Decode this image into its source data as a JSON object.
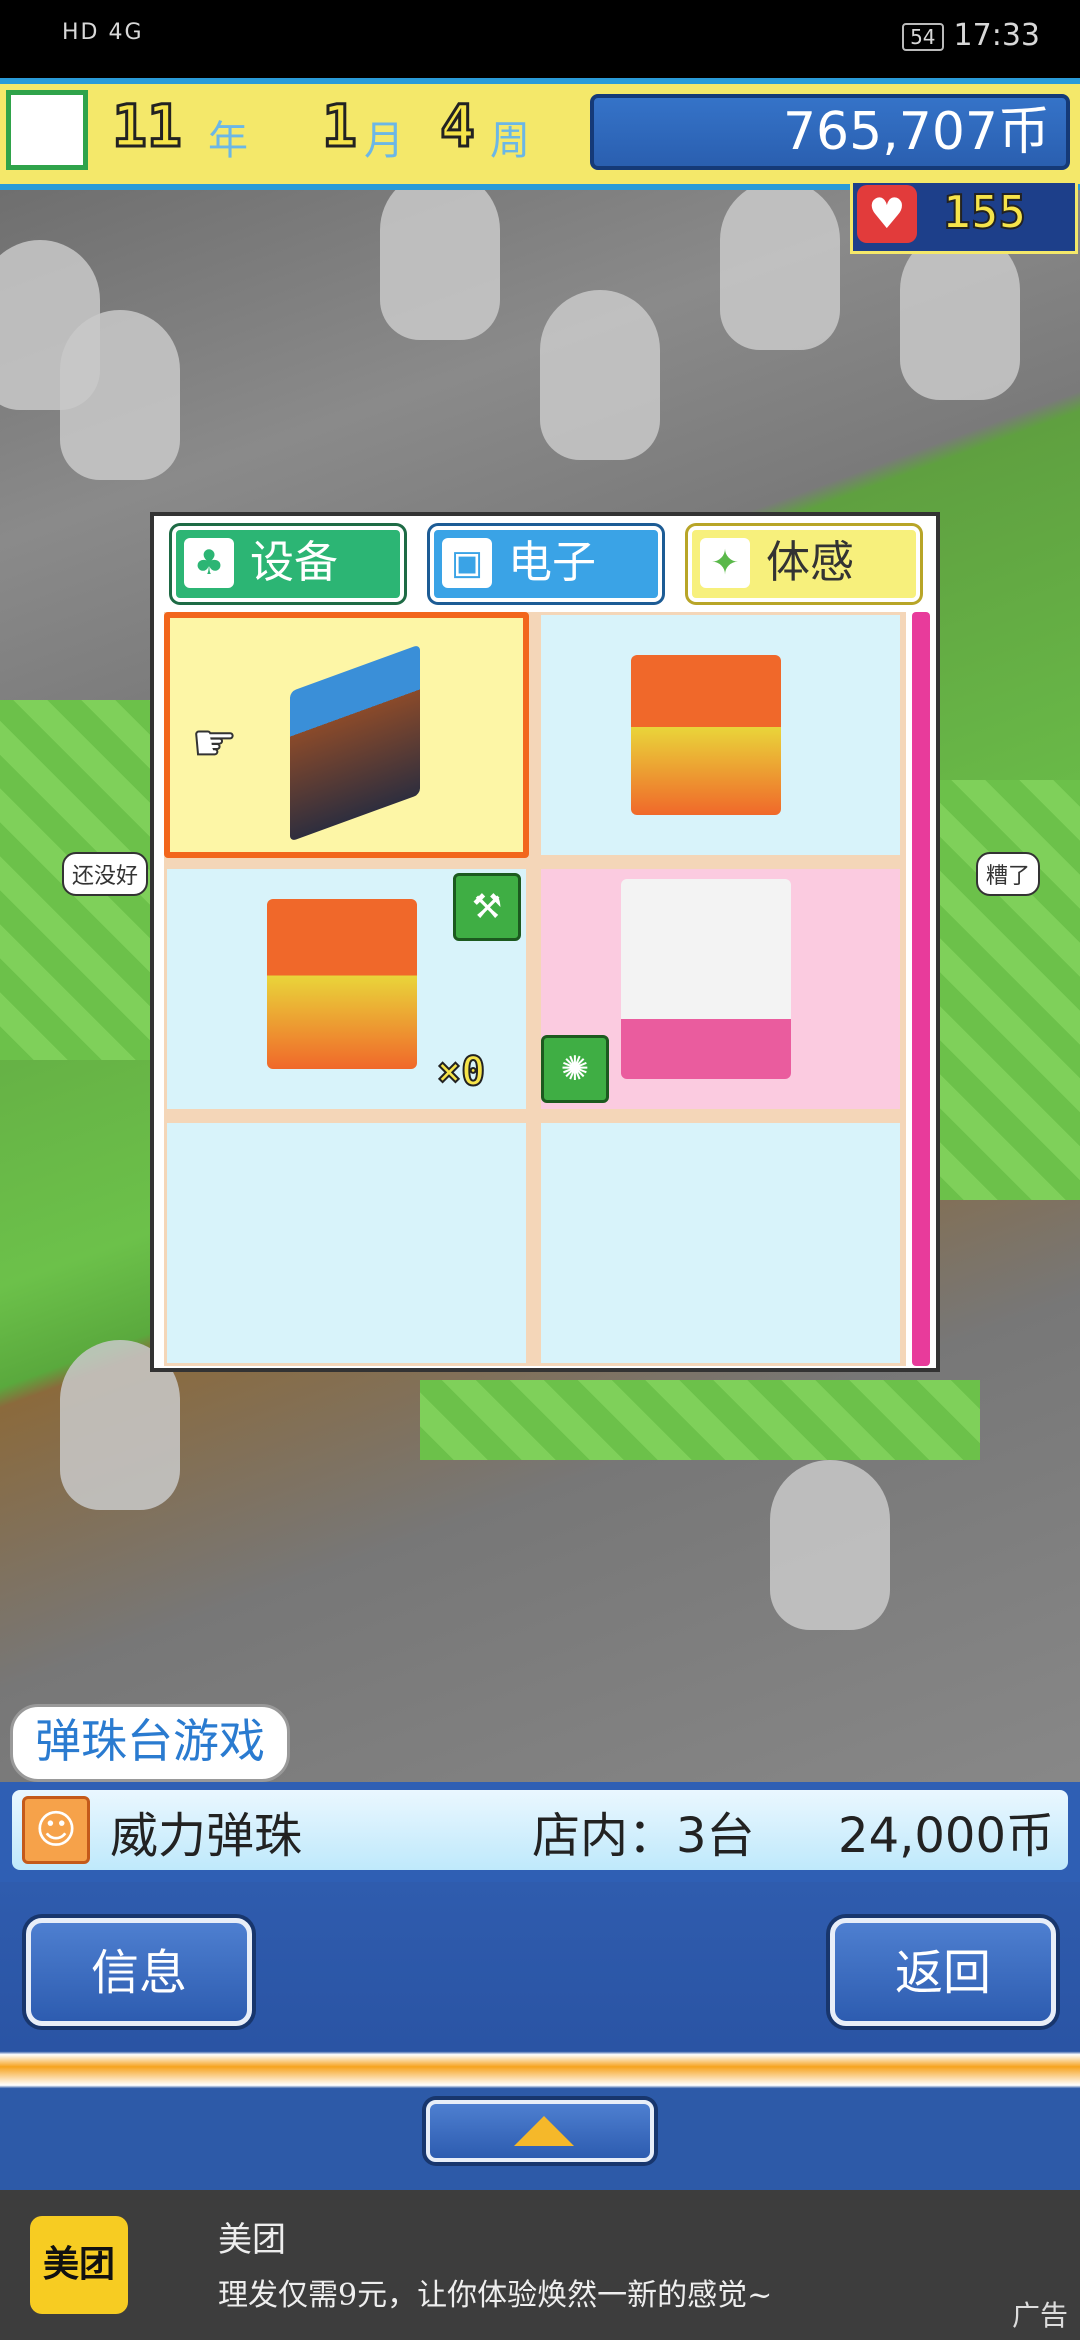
{
  "status_bar": {
    "network": "HD 4G",
    "battery": "54",
    "time": "17:33"
  },
  "hud": {
    "year_value": "11",
    "year_unit": "年",
    "month_value": "1",
    "month_unit": "月",
    "week_value": "4",
    "week_unit": "周",
    "money": "765,707币",
    "hearts": "155"
  },
  "panel": {
    "tabs": [
      {
        "label": "设备",
        "icon": "bench-icon"
      },
      {
        "label": "电子",
        "icon": "computer-icon"
      },
      {
        "label": "体感",
        "icon": "motion-icon"
      }
    ],
    "items": [
      {
        "name": "pinball-machine",
        "selected": true
      },
      {
        "name": "whack-a-mole-machine"
      },
      {
        "name": "whack-a-mole-machine",
        "badge": "wrench-icon",
        "count": "×0"
      },
      {
        "name": "crane-game-machine",
        "badge": "crab-icon"
      }
    ]
  },
  "bubbles": {
    "left": "还没好",
    "right": "糟了"
  },
  "item_info": {
    "category": "弹珠台游戏",
    "name": "威力弹珠",
    "stock": "店内：3台",
    "price": "24,000币"
  },
  "buttons": {
    "info": "信息",
    "back": "返回"
  },
  "ad": {
    "logo": "美团",
    "title": "美团",
    "desc": "理发仅需9元，让你体验焕然一新的感觉~",
    "tag": "广告"
  }
}
